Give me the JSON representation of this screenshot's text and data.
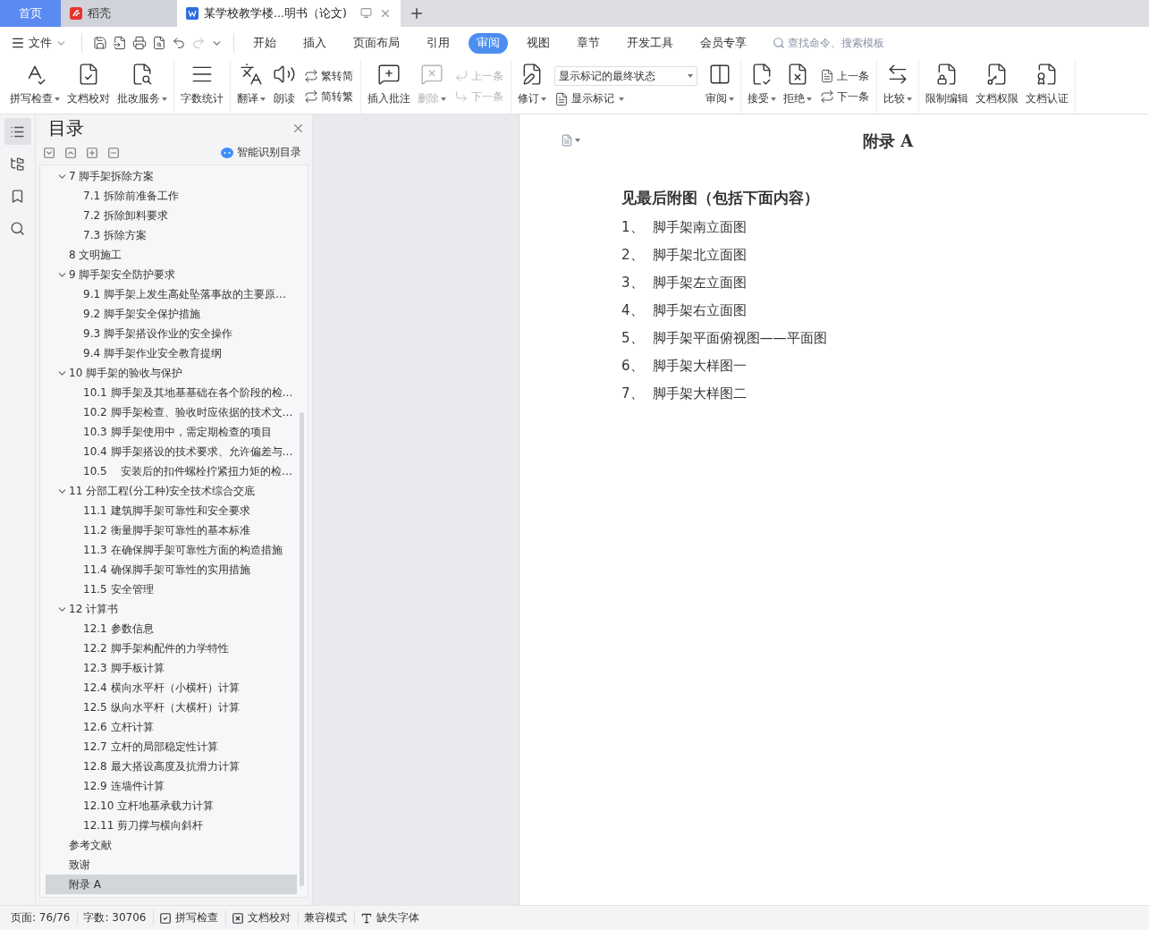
{
  "tabs": [
    {
      "label": "首页",
      "kind": "home",
      "selected": false
    },
    {
      "label": "稻壳",
      "kind": "app",
      "selected": false
    },
    {
      "label": "某学校教学楼...明书（论文)",
      "kind": "doc",
      "selected": true
    }
  ],
  "menu": {
    "file": "文件",
    "tabs": [
      {
        "label": "开始",
        "selected": false
      },
      {
        "label": "插入",
        "selected": false
      },
      {
        "label": "页面布局",
        "selected": false
      },
      {
        "label": "引用",
        "selected": false
      },
      {
        "label": "审阅",
        "selected": true
      },
      {
        "label": "视图",
        "selected": false
      },
      {
        "label": "章节",
        "selected": false
      },
      {
        "label": "开发工具",
        "selected": false
      },
      {
        "label": "会员专享",
        "selected": false
      }
    ],
    "search": {
      "placeholder": "查找命令、搜索模板"
    }
  },
  "ribbon": [
    {
      "items": [
        {
          "kind": "large",
          "label": "拼写检查",
          "dropdown": true,
          "disabled": false
        },
        {
          "kind": "large",
          "label": "文档校对",
          "dropdown": false,
          "disabled": false
        },
        {
          "kind": "large",
          "label": "批改服务",
          "dropdown": true,
          "disabled": false
        }
      ]
    },
    {
      "items": [
        {
          "kind": "large",
          "label": "字数统计",
          "dropdown": false,
          "disabled": false
        }
      ]
    },
    {
      "items": [
        {
          "kind": "large",
          "label": "翻译",
          "dropdown": true,
          "disabled": false
        },
        {
          "kind": "large",
          "label": "朗读",
          "dropdown": false,
          "disabled": false
        },
        {
          "kind": "pair",
          "entries": [
            {
              "label": "繁转简",
              "disabled": false
            },
            {
              "label": "简转繁",
              "disabled": false
            }
          ]
        }
      ]
    },
    {
      "items": [
        {
          "kind": "large",
          "label": "插入批注",
          "dropdown": false,
          "disabled": false
        },
        {
          "kind": "large",
          "label": "删除",
          "dropdown": true,
          "disabled": true
        },
        {
          "kind": "pair",
          "entries": [
            {
              "label": "上一条",
              "disabled": true
            },
            {
              "label": "下一条",
              "disabled": true
            }
          ]
        }
      ]
    },
    {
      "items": [
        {
          "kind": "large",
          "label": "修订",
          "dropdown": true,
          "disabled": false
        },
        {
          "kind": "select",
          "value": "显示标记的最终状态",
          "entry": "显示标记"
        },
        {
          "kind": "large",
          "label": "审阅",
          "dropdown": true,
          "disabled": false
        }
      ]
    },
    {
      "items": [
        {
          "kind": "large",
          "label": "接受",
          "dropdown": true,
          "disabled": false
        },
        {
          "kind": "large",
          "label": "拒绝",
          "dropdown": true,
          "disabled": false
        },
        {
          "kind": "pair",
          "entries": [
            {
              "label": "上一条",
              "disabled": false
            },
            {
              "label": "下一条",
              "disabled": false
            }
          ]
        }
      ]
    },
    {
      "items": [
        {
          "kind": "large",
          "label": "比较",
          "dropdown": true,
          "disabled": false
        }
      ]
    },
    {
      "items": [
        {
          "kind": "large",
          "label": "限制编辑",
          "dropdown": false,
          "disabled": false
        },
        {
          "kind": "large",
          "label": "文档权限",
          "dropdown": false,
          "disabled": false
        },
        {
          "kind": "large",
          "label": "文档认证",
          "dropdown": false,
          "disabled": false
        }
      ]
    }
  ],
  "sidebar": {
    "title": "目录",
    "smart": "智能识别目录",
    "toc": [
      {
        "label": "7 脚手架拆除方案",
        "expanded": true,
        "selected": false,
        "children": [
          {
            "label": "7.1 拆除前准备工作",
            "selected": false
          },
          {
            "label": "7.2 拆除卸料要求",
            "selected": false
          },
          {
            "label": "7.3 拆除方案",
            "selected": false
          }
        ]
      },
      {
        "label": "8 文明施工",
        "selected": false
      },
      {
        "label": "9 脚手架安全防护要求",
        "expanded": true,
        "selected": false,
        "children": [
          {
            "label": "9.1 脚手架上发生高处坠落事故的主要原…",
            "selected": false
          },
          {
            "label": "9.2 脚手架安全保护措施",
            "selected": false
          },
          {
            "label": "9.3 脚手架搭设作业的安全操作",
            "selected": false
          },
          {
            "label": "9.4 脚手架作业安全教育提纲",
            "selected": false
          }
        ]
      },
      {
        "label": "10 脚手架的验收与保护",
        "expanded": true,
        "selected": false,
        "children": [
          {
            "label": "10.1 脚手架及其地基基础在各个阶段的检…",
            "selected": false
          },
          {
            "label": "10.2 脚手架检查、验收时应依据的技术文…",
            "selected": false
          },
          {
            "label": "10.3 脚手架使用中，需定期检查的项目",
            "selected": false
          },
          {
            "label": "10.4 脚手架搭设的技术要求、允许偏差与…",
            "selected": false
          },
          {
            "label": "10.5    安装后的扣件螺栓拧紧扭力矩的检…",
            "selected": false
          }
        ]
      },
      {
        "label": "11 分部工程(分工种)安全技术综合交底",
        "expanded": true,
        "selected": false,
        "children": [
          {
            "label": "11.1 建筑脚手架可靠性和安全要求",
            "selected": false
          },
          {
            "label": "11.2 衡量脚手架可靠性的基本标准",
            "selected": false
          },
          {
            "label": "11.3 在确保脚手架可靠性方面的构造措施",
            "selected": false
          },
          {
            "label": "11.4 确保脚手架可靠性的实用措施",
            "selected": false
          },
          {
            "label": "11.5 安全管理",
            "selected": false
          }
        ]
      },
      {
        "label": "12 计算书",
        "expanded": true,
        "selected": false,
        "children": [
          {
            "label": "12.1 参数信息",
            "selected": false
          },
          {
            "label": "12.2 脚手架构配件的力学特性",
            "selected": false
          },
          {
            "label": "12.3 脚手板计算",
            "selected": false
          },
          {
            "label": "12.4 横向水平杆（小横杆）计算",
            "selected": false
          },
          {
            "label": "12.5 纵向水平杆（大横杆）计算",
            "selected": false
          },
          {
            "label": "12.6 立杆计算",
            "selected": false
          },
          {
            "label": "12.7 立杆的局部稳定性计算",
            "selected": false
          },
          {
            "label": "12.8 最大搭设高度及抗滑力计算",
            "selected": false
          },
          {
            "label": "12.9 连墙件计算",
            "selected": false
          },
          {
            "label": "12.10 立杆地基承载力计算",
            "selected": false
          },
          {
            "label": "12.11 剪刀撑与横向斜杆",
            "selected": false
          }
        ]
      },
      {
        "label": "参考文献",
        "selected": false
      },
      {
        "label": "致谢",
        "selected": false
      },
      {
        "label": "附录 A",
        "selected": true
      }
    ]
  },
  "document": {
    "title": "附录 A",
    "heading": "见最后附图（包括下面内容）",
    "items": [
      {
        "number": "1、",
        "text": "脚手架南立面图"
      },
      {
        "number": "2、",
        "text": "脚手架北立面图"
      },
      {
        "number": "3、",
        "text": "脚手架左立面图"
      },
      {
        "number": "4、",
        "text": "脚手架右立面图"
      },
      {
        "number": "5、",
        "text": "脚手架平面俯视图——平面图"
      },
      {
        "number": "6、",
        "text": "脚手架大样图一"
      },
      {
        "number": "7、",
        "text": "脚手架大样图二"
      }
    ]
  },
  "status_bar": [
    {
      "kind": "text",
      "label": "页面: 76/76"
    },
    {
      "kind": "text",
      "label": "字数: 30706"
    },
    {
      "kind": "check",
      "label": "拼写检查"
    },
    {
      "kind": "proof",
      "label": "文档校对"
    },
    {
      "kind": "text",
      "label": "兼容模式"
    },
    {
      "kind": "font",
      "label": "缺失字体"
    }
  ]
}
